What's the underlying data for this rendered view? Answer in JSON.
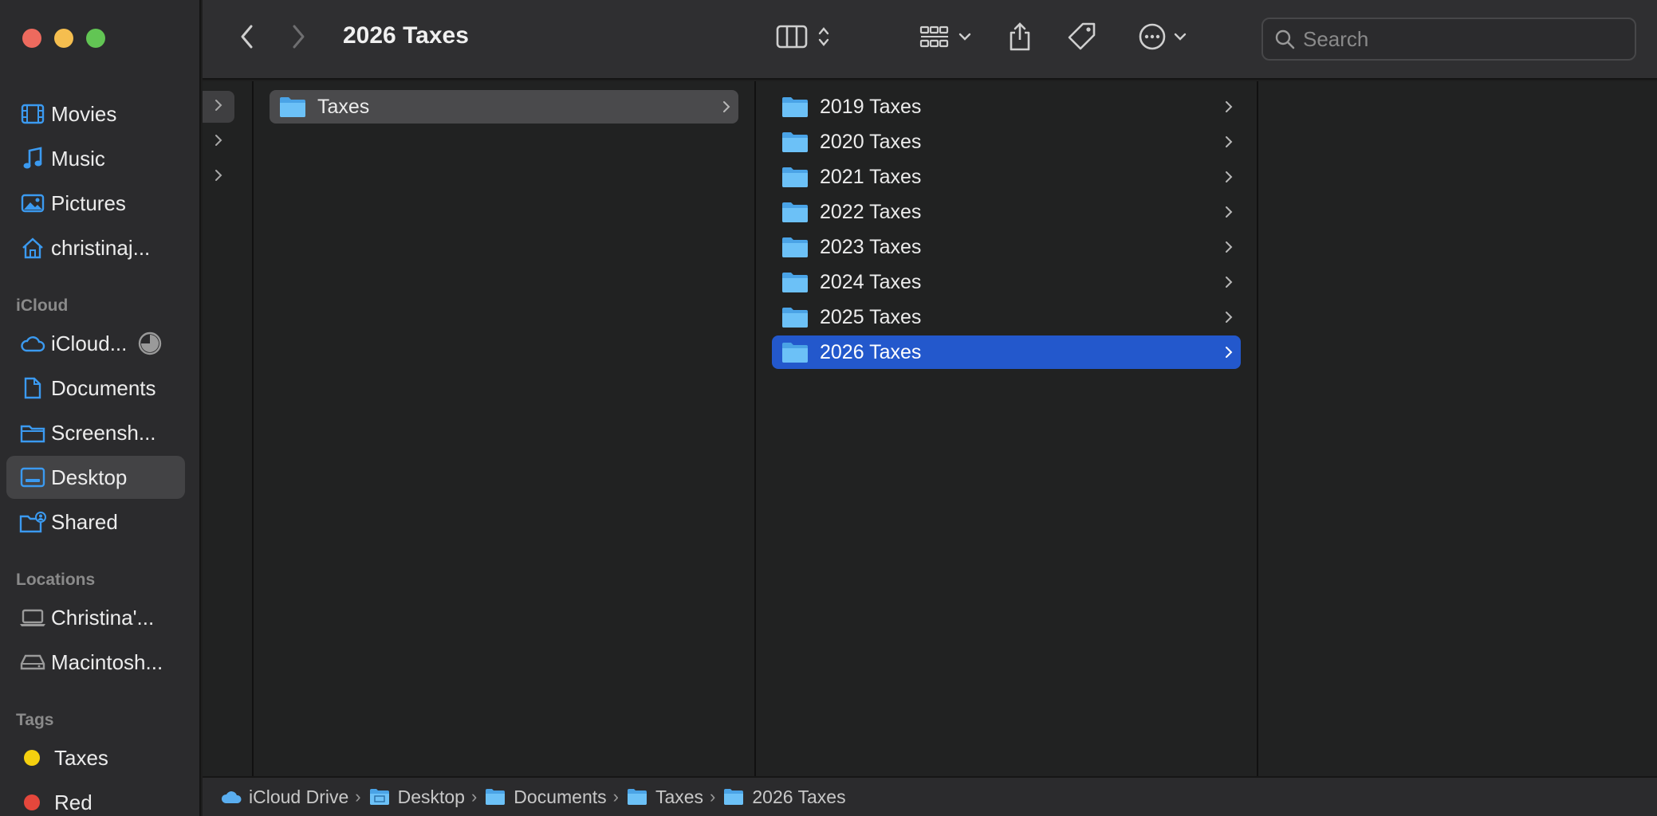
{
  "window": {
    "title": "2026 Taxes"
  },
  "colors": {
    "traffic_close": "#ed6a5e",
    "traffic_minimize": "#f5be4f",
    "traffic_zoom": "#62c554",
    "accent_blue": "#2358cc",
    "sidebar_icon_blue": "#3b9af0",
    "folder_blue": "#5bb8f5",
    "tag_yellow": "#f5d00f",
    "tag_red": "#e5473c"
  },
  "toolbar": {
    "back_icon": "chevron-left-icon",
    "forward_icon": "chevron-right-icon",
    "view_icon": "column-view-icon",
    "group_icon": "grid-icon",
    "share_icon": "share-icon",
    "tag_icon": "tag-icon",
    "more_icon": "ellipsis-circle-icon",
    "search_placeholder": "Search"
  },
  "sidebar": {
    "favorites": [
      {
        "label": "Movies",
        "icon": "film-icon"
      },
      {
        "label": "Music",
        "icon": "music-note-icon"
      },
      {
        "label": "Pictures",
        "icon": "photo-icon"
      },
      {
        "label": "christinaj...",
        "icon": "home-icon"
      }
    ],
    "icloud_header": "iCloud",
    "icloud": [
      {
        "label": "iCloud...",
        "icon": "cloud-icon"
      },
      {
        "label": "Documents",
        "icon": "document-icon"
      },
      {
        "label": "Screensh...",
        "icon": "folder-icon"
      },
      {
        "label": "Desktop",
        "icon": "desktop-icon",
        "active": true
      },
      {
        "label": "Shared",
        "icon": "shared-folder-icon"
      }
    ],
    "locations_header": "Locations",
    "locations": [
      {
        "label": "Christina'...",
        "icon": "laptop-icon"
      },
      {
        "label": "Macintosh...",
        "icon": "disk-icon"
      }
    ],
    "tags_header": "Tags",
    "tags": [
      {
        "label": "Taxes",
        "color": "#f5d00f"
      },
      {
        "label": "Red",
        "color": "#e5473c"
      }
    ]
  },
  "columns": {
    "col2": [
      {
        "label": "Taxes",
        "selected": "grey"
      }
    ],
    "col3": [
      {
        "label": "2019 Taxes"
      },
      {
        "label": "2020 Taxes"
      },
      {
        "label": "2021 Taxes"
      },
      {
        "label": "2022 Taxes"
      },
      {
        "label": "2023 Taxes"
      },
      {
        "label": "2024 Taxes"
      },
      {
        "label": "2025 Taxes"
      },
      {
        "label": "2026 Taxes",
        "selected": "blue"
      }
    ]
  },
  "pathbar": [
    {
      "label": "iCloud Drive",
      "icon": "cloud-icon"
    },
    {
      "label": "Desktop",
      "icon": "desktop-folder-icon"
    },
    {
      "label": "Documents",
      "icon": "folder-icon"
    },
    {
      "label": "Taxes",
      "icon": "folder-icon"
    },
    {
      "label": "2026 Taxes",
      "icon": "folder-icon"
    }
  ]
}
